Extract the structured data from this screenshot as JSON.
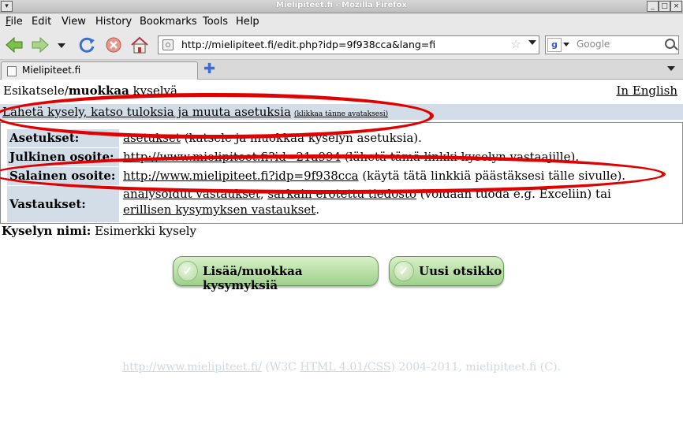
{
  "window": {
    "title": "Mielipiteet.fi - Mozilla Firefox"
  },
  "menu": {
    "items": [
      "File",
      "Edit",
      "View",
      "History",
      "Bookmarks",
      "Tools",
      "Help"
    ],
    "mnemonics": [
      "F",
      "E",
      "V",
      "s",
      "B",
      "T",
      "H"
    ]
  },
  "nav": {
    "url": "http://mielipiteet.fi/edit.php?idp=9f938cca&lang=fi",
    "search_placeholder": "Google"
  },
  "tabs": [
    {
      "label": "Mielipiteet.fi"
    }
  ],
  "page": {
    "header_prefix": "Esikatsele/",
    "header_bold": "muokkaa",
    "header_suffix": " kyselyä",
    "english_link": "In English",
    "send_link": "Lähetä kysely, katso tuloksia ja muuta asetuksia",
    "send_hint": "(klikkaa tänne avataksesi)",
    "rows": [
      {
        "label": "Asetukset:",
        "link": "asetukset",
        "text": " (katsele ja muokkaa kyselyn asetuksia)."
      },
      {
        "label": "Julkinen osoite:",
        "link": "http://www.mielipiteet.fi?id=21a994",
        "text": " (lähetä tämä linkki kyselyn vastaajille)."
      },
      {
        "label": "Salainen osoite:",
        "link": "http://www.mielipiteet.fi?idp=9f938cca",
        "text": " (käytä tätä linkkiä päästäksesi tälle sivulle)."
      },
      {
        "label": "Vastaukset:",
        "link": "analysoidut vastaukset",
        "sep": ", ",
        "link2": "sarkain erotettu tiedosto",
        "text": " (voidaan tuoda e.g. Exceliin) tai ",
        "link3": "erillisen kysymyksen vastaukset",
        "end": "."
      }
    ],
    "survey_name_label": "Kyselyn nimi:",
    "survey_name": " Esimerkki kysely",
    "buttons": {
      "edit_questions": "Lisää/muokkaa kysymyksiä",
      "new_heading": "Uusi otsikko"
    },
    "footer": {
      "site_link": "http://www.mielipiteet.fi/",
      "w3c_prefix": " (W3C ",
      "standards_link": "HTML 4.01/CSS",
      "suffix": ") 2004-2011, mielipiteet.fi (C)."
    }
  },
  "colors": {
    "annotation": "#e00000",
    "label_bg": "#d3dde8",
    "button_green": "#9fd08c"
  }
}
